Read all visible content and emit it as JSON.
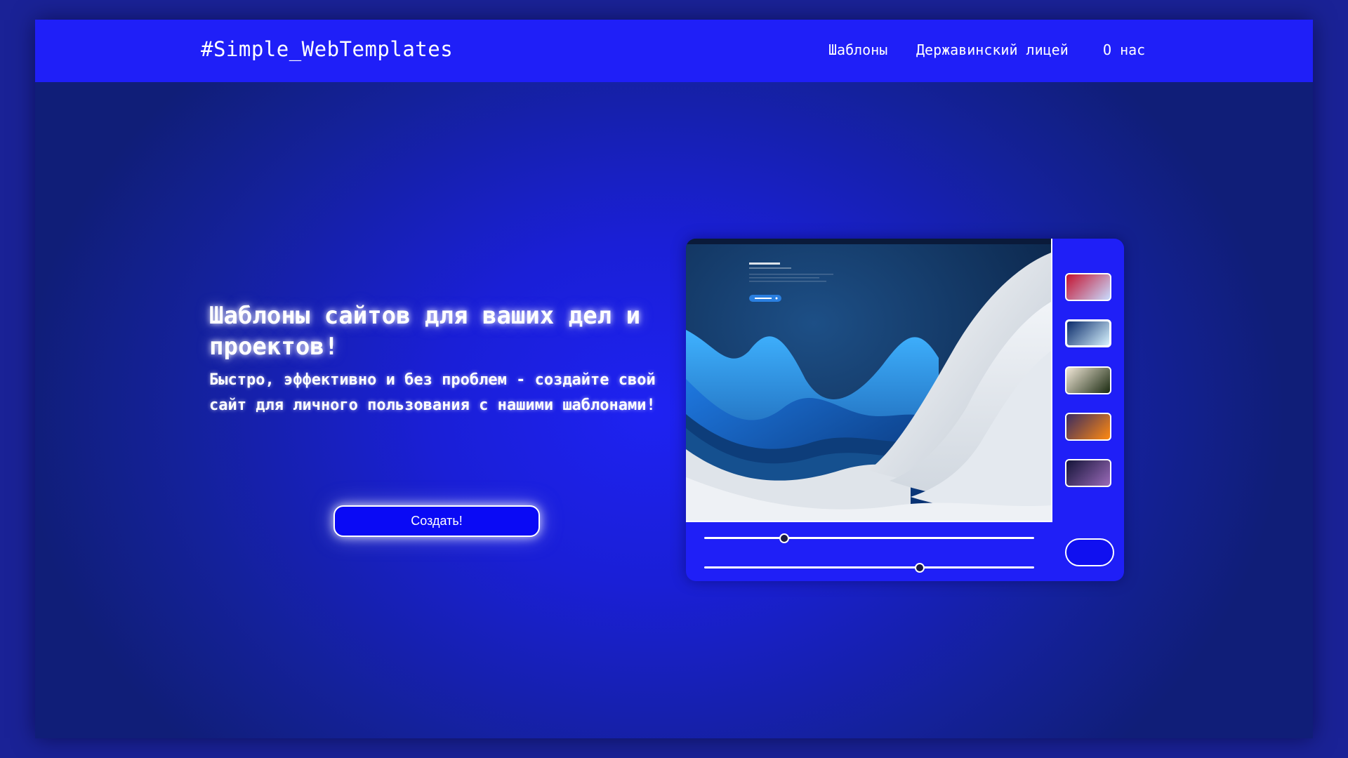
{
  "header": {
    "logo": "#Simple_WebTemplates",
    "nav": [
      {
        "label": "Шаблоны"
      },
      {
        "label": "Державинский лицей"
      },
      {
        "label": "О нас"
      }
    ]
  },
  "hero": {
    "title": "Шаблоны сайтов для ваших дел и проектов!",
    "subtitle": "Быстро, эффективно и без проблем - создайте свой сайт для личного пользования с нашими шаблонами!",
    "cta_label": "Создать!"
  },
  "editor": {
    "swatches": [
      {
        "name": "red-blue-gradient",
        "from": "#c4122f",
        "to": "#c8dcff"
      },
      {
        "name": "navy-cyan-gradient",
        "from": "#0a2a6a",
        "to": "#d8f4ff",
        "selected": true
      },
      {
        "name": "cream-olive-gradient",
        "from": "#f2e8d8",
        "to": "#1a2a10"
      },
      {
        "name": "orange-gradient",
        "from": "#3a2a60",
        "to": "#ff8a10"
      },
      {
        "name": "dark-purple-gradient",
        "from": "#141438",
        "to": "#9a6ab8"
      }
    ],
    "sliders": [
      {
        "name": "slider-1",
        "value": 0.24
      },
      {
        "name": "slider-2",
        "value": 0.65
      }
    ]
  },
  "colors": {
    "topbar": "#1f1ff8",
    "accent": "#0a0af5",
    "panel": "#1f1ff7"
  }
}
